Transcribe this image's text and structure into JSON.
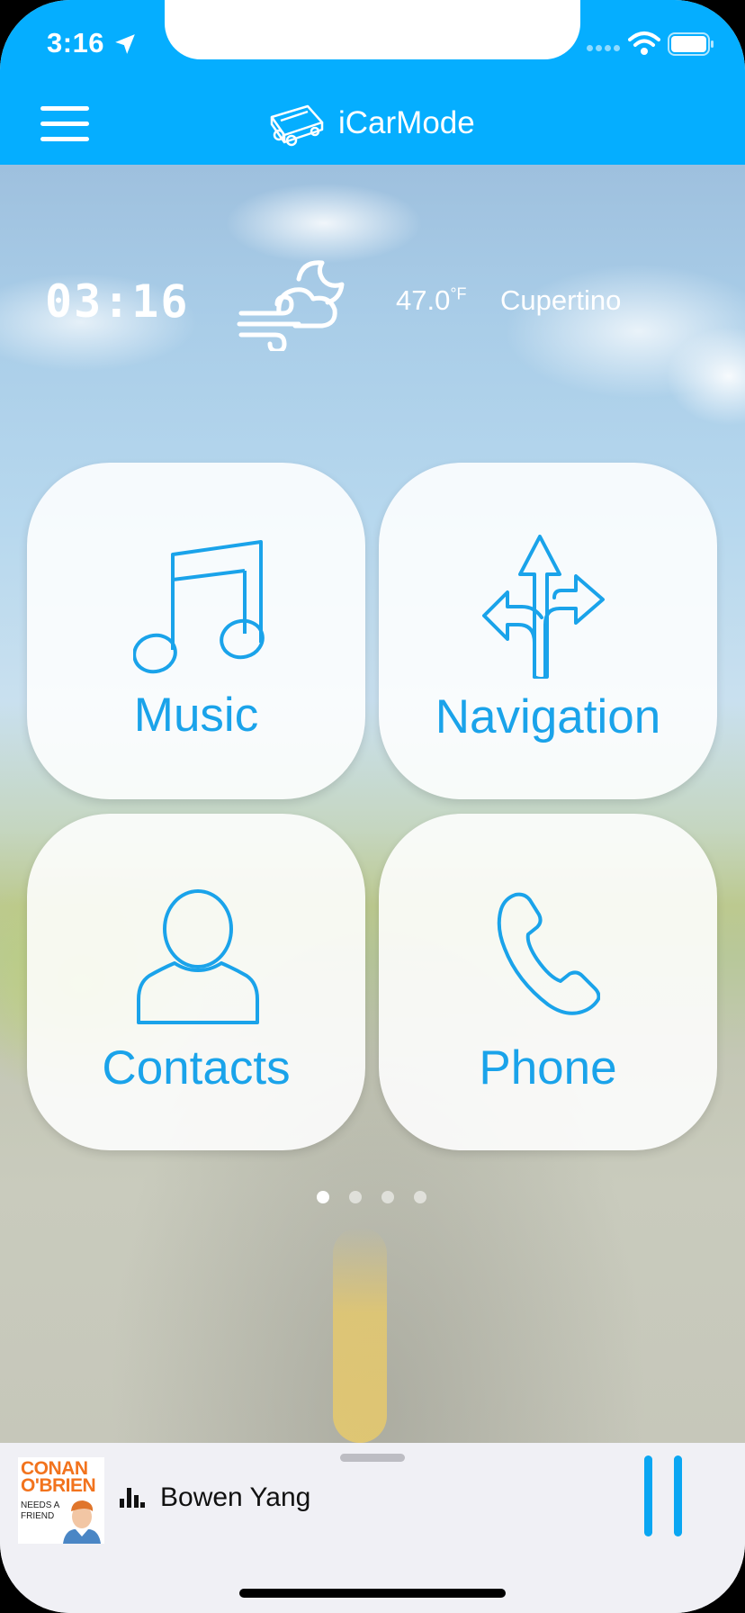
{
  "status_bar": {
    "time": "3:16"
  },
  "header": {
    "title": "iCarMode"
  },
  "info": {
    "clock": "03:16",
    "temperature": "47.0",
    "temperature_unit": "°F",
    "city": "Cupertino",
    "weather_icon": "wind-cloud-moon-icon"
  },
  "tiles": [
    {
      "label": "Music",
      "icon": "music-note-icon"
    },
    {
      "label": "Navigation",
      "icon": "directions-arrows-icon"
    },
    {
      "label": "Contacts",
      "icon": "person-icon"
    },
    {
      "label": "Phone",
      "icon": "phone-handset-icon"
    }
  ],
  "pager": {
    "page_count": 4,
    "active_page": 1
  },
  "player": {
    "artwork_line1": "CONAN",
    "artwork_line2": "O'BRIEN",
    "artwork_line3": "NEEDS A FRIEND",
    "track": "Bowen Yang",
    "state": "playing"
  },
  "colors": {
    "accent": "#05aeff",
    "tile_text": "#1aa3ea",
    "player_bg": "#f0f0f5"
  }
}
